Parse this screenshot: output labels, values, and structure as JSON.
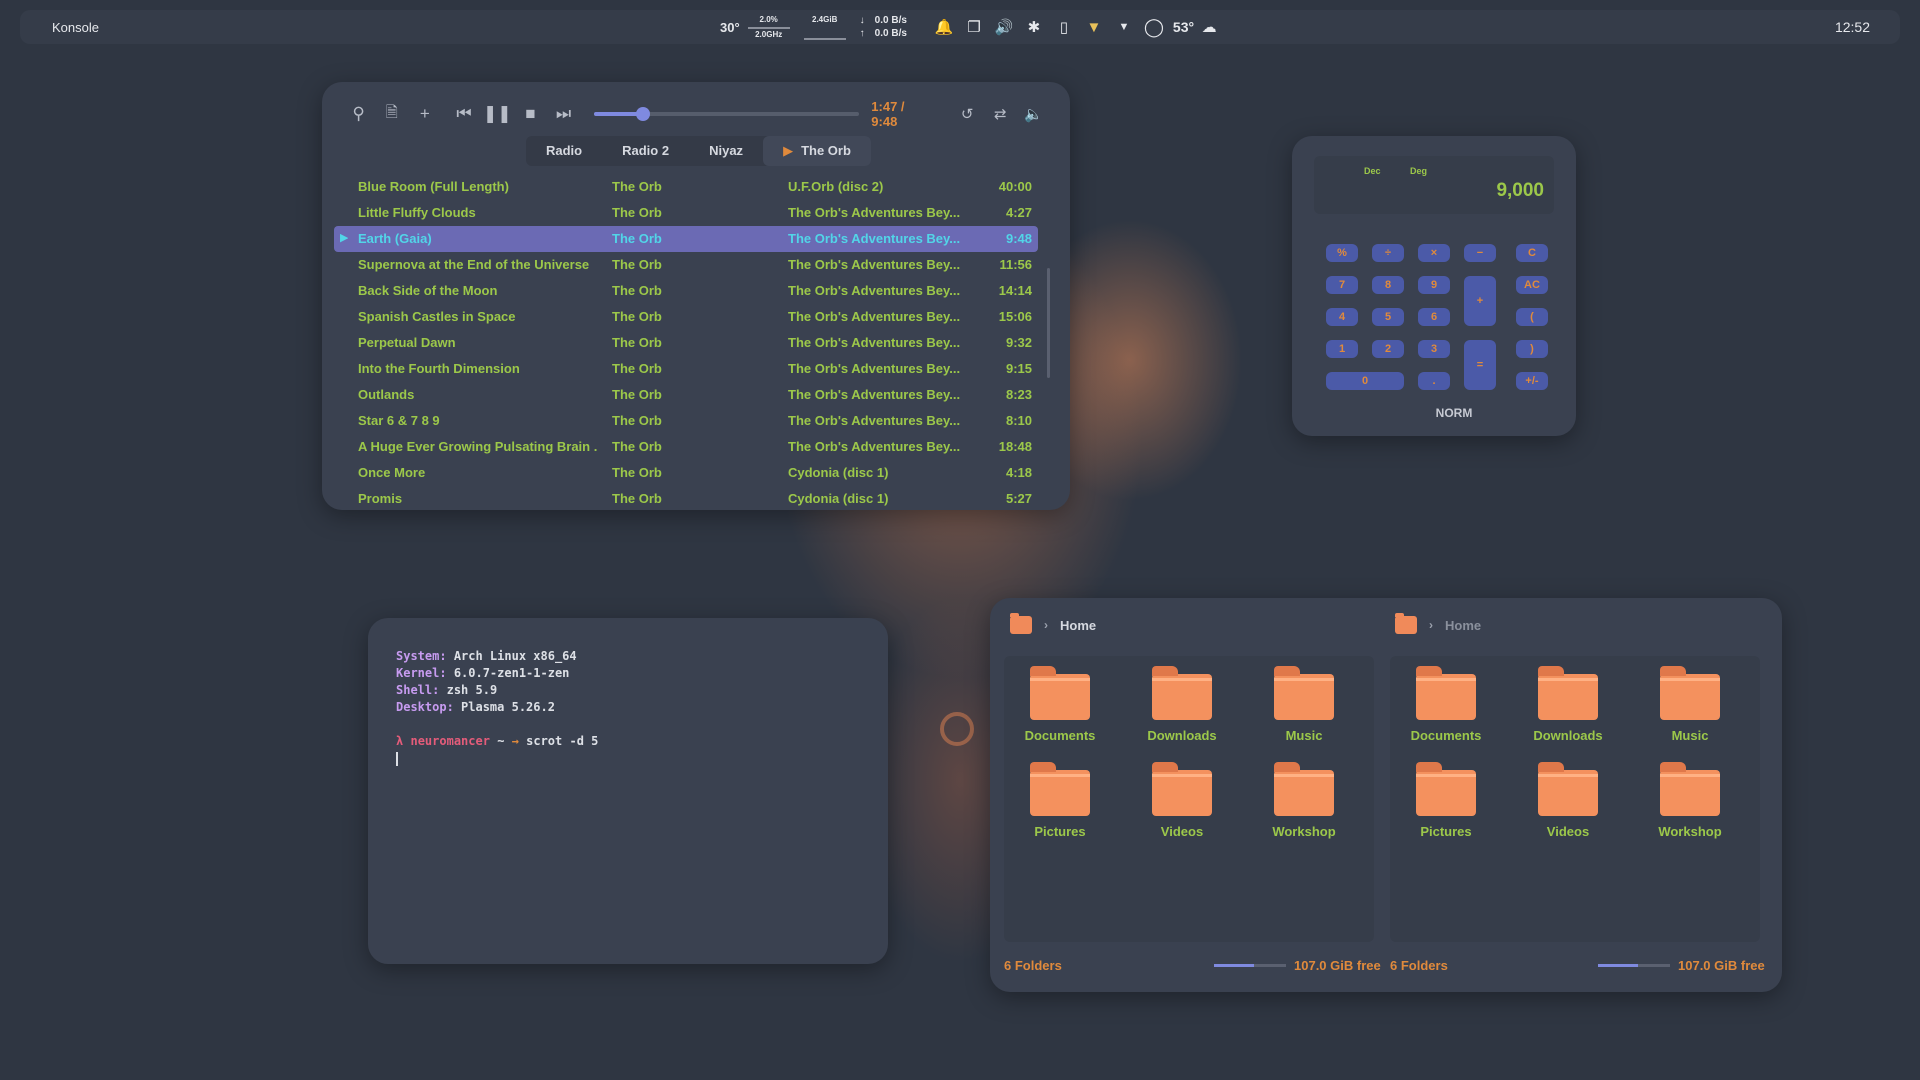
{
  "panel": {
    "app_title": "Konsole",
    "clock": "12:52",
    "temp": "30°",
    "cpu_usage": "2.0%",
    "cpu_freq": "2.0GHz",
    "memory": "2.4GiB",
    "net_down": "0.0 B/s",
    "net_up": "0.0 B/s",
    "net_down_arrow": "↓",
    "net_up_arrow": "↑",
    "weather": "53°",
    "icons": [
      "bell-icon",
      "clipboard-icon",
      "volume-icon",
      "bluetooth-icon",
      "phone-icon",
      "wifi-icon",
      "tray-expand-icon",
      "circle-icon",
      "cloud-icon"
    ]
  },
  "player": {
    "time": "1:47 / 9:48",
    "progress": 0.18,
    "tabs": [
      "Radio",
      "Radio 2",
      "Niyaz",
      "The Orb"
    ],
    "active_tab": 3,
    "tracks": [
      {
        "title": "Blue Room (Full Length)",
        "artist": "The Orb",
        "album": "U.F.Orb (disc 2)",
        "length": "40:00"
      },
      {
        "title": "Little Fluffy Clouds",
        "artist": "The Orb",
        "album": "The Orb's Adventures Bey...",
        "length": "4:27"
      },
      {
        "title": "Earth (Gaia)",
        "artist": "The Orb",
        "album": "The Orb's Adventures Bey...",
        "length": "9:48"
      },
      {
        "title": "Supernova at the End of the Universe",
        "artist": "The Orb",
        "album": "The Orb's Adventures Bey...",
        "length": "11:56"
      },
      {
        "title": "Back Side of the Moon",
        "artist": "The Orb",
        "album": "The Orb's Adventures Bey...",
        "length": "14:14"
      },
      {
        "title": "Spanish Castles in Space",
        "artist": "The Orb",
        "album": "The Orb's Adventures Bey...",
        "length": "15:06"
      },
      {
        "title": "Perpetual Dawn",
        "artist": "The Orb",
        "album": "The Orb's Adventures Bey...",
        "length": "9:32"
      },
      {
        "title": "Into the Fourth Dimension",
        "artist": "The Orb",
        "album": "The Orb's Adventures Bey...",
        "length": "9:15"
      },
      {
        "title": "Outlands",
        "artist": "The Orb",
        "album": "The Orb's Adventures Bey...",
        "length": "8:23"
      },
      {
        "title": "Star 6 & 7 8 9",
        "artist": "The Orb",
        "album": "The Orb's Adventures Bey...",
        "length": "8:10"
      },
      {
        "title": "A Huge Ever Growing Pulsating Brain ...",
        "artist": "The Orb",
        "album": "The Orb's Adventures Bey...",
        "length": "18:48"
      },
      {
        "title": "Once More",
        "artist": "The Orb",
        "album": "Cydonia (disc 1)",
        "length": "4:18"
      },
      {
        "title": "Promis",
        "artist": "The Orb",
        "album": "Cydonia (disc 1)",
        "length": "5:27"
      }
    ],
    "current_index": 2,
    "now_playing_glyph": "▶"
  },
  "calculator": {
    "mode_dec": "Dec",
    "mode_deg": "Deg",
    "display": "9,000",
    "keys": {
      "percent": "%",
      "divide": "÷",
      "multiply": "×",
      "minus": "−",
      "clear": "C",
      "seven": "7",
      "eight": "8",
      "nine": "9",
      "plus": "+",
      "all_clear": "AC",
      "four": "4",
      "five": "5",
      "six": "6",
      "open_paren": "(",
      "one": "1",
      "two": "2",
      "three": "3",
      "equals": "=",
      "close_paren": ")",
      "zero": "0",
      "decimal": ".",
      "negate": "+/-"
    },
    "status": "NORM"
  },
  "terminal": {
    "lines": [
      {
        "key": "System:",
        "value": "Arch Linux x86_64"
      },
      {
        "key": "Kernel:",
        "value": "6.0.7-zen1-1-zen"
      },
      {
        "key": "Shell:",
        "value": "zsh 5.9"
      },
      {
        "key": "Desktop:",
        "value": "Plasma 5.26.2"
      }
    ],
    "prompt_symbol": "λ",
    "host": "neuromancer",
    "cwd": "~",
    "arrow": "→",
    "command": "scrot -d 5"
  },
  "files": {
    "left": {
      "breadcrumb": "Home",
      "folders": [
        "Documents",
        "Downloads",
        "Music",
        "Pictures",
        "Videos",
        "Workshop"
      ],
      "status": "6 Folders",
      "free": "107.0 GiB free"
    },
    "right": {
      "breadcrumb": "Home",
      "folders": [
        "Documents",
        "Downloads",
        "Music",
        "Pictures",
        "Videos",
        "Workshop"
      ],
      "status": "6 Folders",
      "free": "107.0 GiB free"
    },
    "disk_usage": 0.55
  },
  "colors": {
    "accent_orange": "#e08a3c",
    "text_green": "#9cc84a",
    "highlight_purple": "#6b6ab4",
    "now_playing_cyan": "#52d5e8",
    "folder_orange": "#f4915e",
    "window_bg": "#3a4150"
  }
}
